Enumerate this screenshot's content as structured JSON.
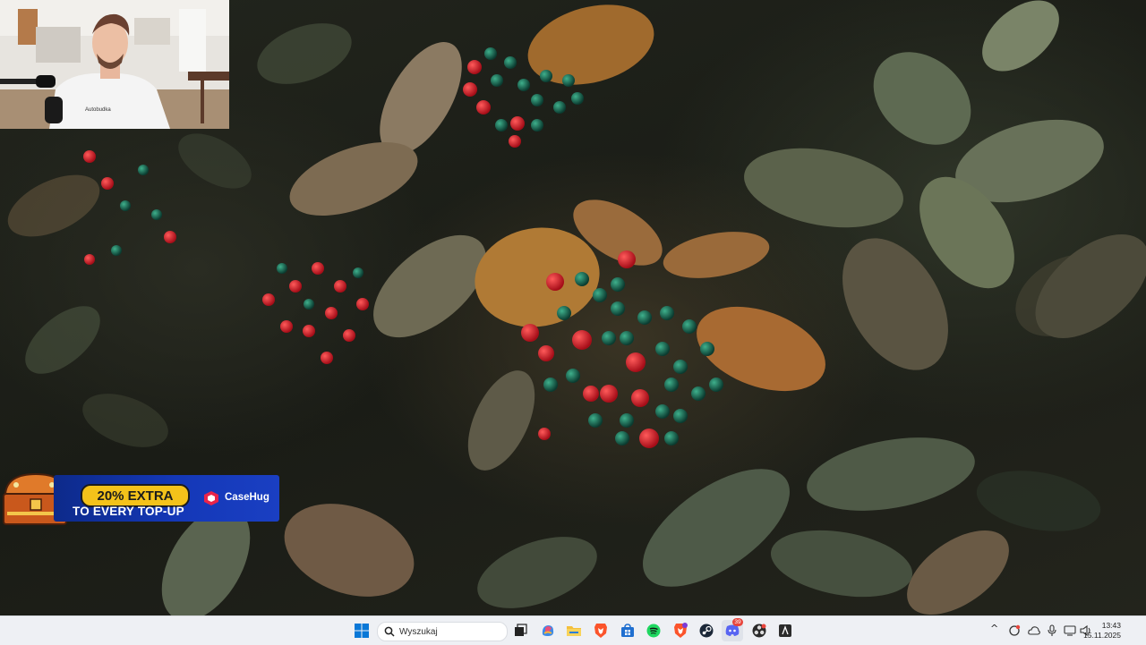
{
  "promo": {
    "headline": "20% EXTRA",
    "subline": "TO EVERY TOP-UP",
    "brand": "CaseHug"
  },
  "webcam": {
    "shirt_text": "Autobudka"
  },
  "taskbar": {
    "search_label": "Wyszukaj",
    "items": [
      {
        "name": "start-icon"
      },
      {
        "name": "search-icon"
      },
      {
        "name": "task-view-icon"
      },
      {
        "name": "copilot-icon"
      },
      {
        "name": "file-explorer-icon"
      },
      {
        "name": "brave-browser-icon"
      },
      {
        "name": "microsoft-store-icon"
      },
      {
        "name": "spotify-icon"
      },
      {
        "name": "brave-browser-icon-2"
      },
      {
        "name": "steam-icon"
      },
      {
        "name": "discord-icon",
        "badge": "39"
      },
      {
        "name": "obs-icon"
      },
      {
        "name": "app-icon"
      }
    ],
    "tray": {
      "time": "13:43",
      "date": "15.11.2025"
    }
  },
  "colors": {
    "taskbar_bg": "#eef0f4",
    "promo_blue": "#1438b8",
    "promo_yellow": "#f4c21a",
    "discord_badge": "#e8453c"
  }
}
